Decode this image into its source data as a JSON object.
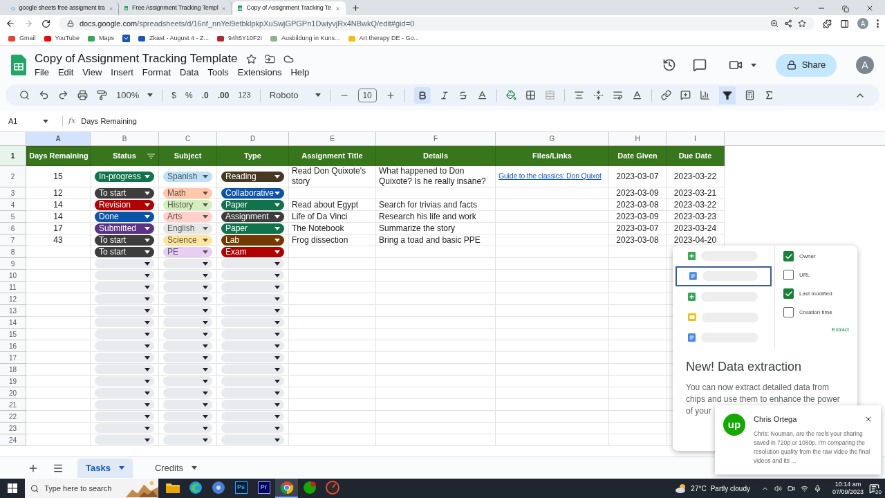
{
  "browser": {
    "tabs": [
      {
        "title": "google sheets free assigment tra",
        "kind": "google",
        "selected": false
      },
      {
        "title": "Free Assignment Tracking Templ",
        "kind": "sheets",
        "selected": false
      },
      {
        "title": "Copy of Assignment Tracking Te",
        "kind": "sheets",
        "selected": true
      }
    ],
    "url_host": "docs.google.com",
    "url_path": "/spreadsheets/d/16nf_nnYel9etbklpkpXuSwjGPGPn1DwiyvjRx4NBwkQ/edit#gid=0",
    "profile": "A",
    "bookmarks": [
      {
        "label": "Gmail",
        "color": "#ea4335"
      },
      {
        "label": "YouTube",
        "color": "#ff0000"
      },
      {
        "label": "Maps",
        "color": "#34a853"
      },
      {
        "label": "Zkast - August 4 - Z...",
        "color": "#1a56b8"
      },
      {
        "label": "94h5Y10F2I",
        "color": "#b3262d"
      },
      {
        "label": "Ausbildung in Kuns...",
        "color": "#8ab58a"
      },
      {
        "label": "Art therapy DE - Go...",
        "color": "#fbbc04"
      }
    ]
  },
  "sheets": {
    "title": "Copy of Assignment Tracking Template",
    "menu": [
      "File",
      "Edit",
      "View",
      "Insert",
      "Format",
      "Data",
      "Tools",
      "Extensions",
      "Help"
    ],
    "share": "Share",
    "avatar": "A"
  },
  "toolbar": {
    "zoom": "100%",
    "currency": "$",
    "percent": "%",
    "decrease_decimal": ".0",
    "increase_decimal": ".00",
    "number_format": "123",
    "font": "Roboto",
    "font_size": "10",
    "bold_selected": true,
    "filter_selected": true
  },
  "formula_bar": {
    "cell": "A1",
    "fx_label": "fx",
    "content": "Days Remaining"
  },
  "grid": {
    "columns": [
      {
        "letter": "A",
        "selected": true
      },
      {
        "letter": "B",
        "selected": false
      },
      {
        "letter": "C",
        "selected": false
      },
      {
        "letter": "D",
        "selected": false
      },
      {
        "letter": "E",
        "selected": false
      },
      {
        "letter": "F",
        "selected": false
      },
      {
        "letter": "G",
        "selected": false
      },
      {
        "letter": "H",
        "selected": false
      },
      {
        "letter": "I",
        "selected": false
      }
    ],
    "header_row": {
      "number": "1",
      "cells": [
        {
          "label": "Days Remaining",
          "filter": false
        },
        {
          "label": "Status",
          "filter": true
        },
        {
          "label": "Subject",
          "filter": false
        },
        {
          "label": "Type",
          "filter": false
        },
        {
          "label": "Assignment Title",
          "filter": false
        },
        {
          "label": "Details",
          "filter": false
        },
        {
          "label": "Files/Links",
          "filter": false
        },
        {
          "label": "Date Given",
          "filter": false
        },
        {
          "label": "Due Date",
          "filter": false
        }
      ]
    },
    "rows": [
      {
        "number": "2",
        "kind": "filled",
        "days": "15",
        "status": {
          "label": "In-progress",
          "color": "#11734b"
        },
        "subject": {
          "label": "Spanish",
          "color": "#bfe1f6"
        },
        "type": {
          "label": "Reading",
          "color": "#473821"
        },
        "title": "Read Don Quixote's story",
        "details": "What happened to Don Quixote? Is he really insane?",
        "link": "Guide to the classics: Don Quixot",
        "given": "2023-03-07",
        "due": "2023-03-22"
      },
      {
        "number": "3",
        "kind": "filled",
        "days": "12",
        "status": {
          "label": "To start",
          "color": "#3d3d3d"
        },
        "subject": {
          "label": "Math",
          "color": "#ffc8aa"
        },
        "type": {
          "label": "Collaborative",
          "color": "#0a53a8"
        },
        "given": "2023-03-09",
        "due": "2023-03-21"
      },
      {
        "number": "4",
        "kind": "filled",
        "days": "14",
        "status": {
          "label": "Revision",
          "color": "#b10202"
        },
        "subject": {
          "label": "History",
          "color": "#d4edbc"
        },
        "type": {
          "label": "Paper",
          "color": "#11734b"
        },
        "title": "Read about Egypt",
        "details": "Search for trivias and facts",
        "given": "2023-03-08",
        "due": "2023-03-22"
      },
      {
        "number": "5",
        "kind": "filled",
        "days": "14",
        "status": {
          "label": "Done",
          "color": "#0a53a8"
        },
        "subject": {
          "label": "Arts",
          "color": "#ffcfc9"
        },
        "type": {
          "label": "Assignment",
          "color": "#3d3d3d"
        },
        "title": "Life of Da Vinci",
        "details": "Research his life and work",
        "given": "2023-03-09",
        "due": "2023-03-23"
      },
      {
        "number": "6",
        "kind": "filled",
        "days": "17",
        "status": {
          "label": "Submitted",
          "color": "#5a3286"
        },
        "subject": {
          "label": "English",
          "color": "#e6e6e6"
        },
        "type": {
          "label": "Paper",
          "color": "#11734b"
        },
        "title": "The Notebook",
        "details": "Summarize the story",
        "given": "2023-03-07",
        "due": "2023-03-24"
      },
      {
        "number": "7",
        "kind": "filled",
        "days": "43",
        "status": {
          "label": "To start",
          "color": "#3d3d3d"
        },
        "subject": {
          "label": "Science",
          "color": "#ffe5a0"
        },
        "type": {
          "label": "Lab",
          "color": "#753800"
        },
        "title": "Frog dissection",
        "details": "Bring a toad and basic PPE",
        "given": "2023-03-08",
        "due": "2023-04-20"
      },
      {
        "number": "8",
        "kind": "filled",
        "status": {
          "label": "To start",
          "color": "#3d3d3d"
        },
        "subject": {
          "label": "PE",
          "color": "#e6cff2"
        },
        "type": {
          "label": "Exam",
          "color": "#b10202"
        }
      },
      {
        "number": "9",
        "kind": "blank"
      },
      {
        "number": "10",
        "kind": "blank"
      },
      {
        "number": "11",
        "kind": "blank"
      },
      {
        "number": "12",
        "kind": "blank"
      },
      {
        "number": "13",
        "kind": "blank"
      },
      {
        "number": "14",
        "kind": "blank"
      },
      {
        "number": "15",
        "kind": "blank"
      },
      {
        "number": "16",
        "kind": "blank"
      },
      {
        "number": "17",
        "kind": "blank"
      },
      {
        "number": "18",
        "kind": "blank"
      },
      {
        "number": "19",
        "kind": "blank"
      },
      {
        "number": "20",
        "kind": "blank"
      },
      {
        "number": "21",
        "kind": "blank"
      },
      {
        "number": "22",
        "kind": "blank"
      },
      {
        "number": "23",
        "kind": "blank"
      },
      {
        "number": "24",
        "kind": "blank"
      }
    ]
  },
  "sheet_tabs": [
    {
      "label": "Tasks",
      "selected": true
    },
    {
      "label": "Credits",
      "selected": false
    }
  ],
  "popup": {
    "files": [
      {
        "kind": "sheet",
        "selected": false
      },
      {
        "kind": "doc",
        "selected": true
      },
      {
        "kind": "sheet",
        "selected": false
      },
      {
        "kind": "slide",
        "selected": false
      },
      {
        "kind": "doc",
        "selected": false
      }
    ],
    "fields": [
      {
        "label": "Owner",
        "checked": true
      },
      {
        "label": "URL",
        "checked": false
      },
      {
        "label": "Last modified",
        "checked": true
      },
      {
        "label": "Creation time",
        "checked": false
      }
    ],
    "action": "Extract",
    "title": "New! Data extraction",
    "body": "You can now extract detailed data from chips and use them to enhance the power of your"
  },
  "notification": {
    "badge": "up",
    "sender": "Chris Ortega",
    "message": "Chris: Nouman, are the reels your sharing saved in 720p or 1080p. I'm comparing the resolution quality from the raw video the final videos and its ..."
  },
  "taskbar": {
    "search_placeholder": "Type here to search",
    "apps": [
      {
        "kind": "folder",
        "selected": false
      },
      {
        "kind": "edge",
        "selected": false
      },
      {
        "kind": "disc",
        "selected": false
      },
      {
        "kind": "ps",
        "label": "Ps",
        "selected": false
      },
      {
        "kind": "pr",
        "label": "Pr",
        "selected": false
      },
      {
        "kind": "chrome",
        "selected": true
      },
      {
        "kind": "upwork",
        "selected": false
      },
      {
        "kind": "dial",
        "selected": false
      }
    ],
    "temperature": "27°C",
    "weather": "Partly cloudy",
    "time": "10:14 am",
    "date": "07/09/2023",
    "notifications": "20"
  }
}
